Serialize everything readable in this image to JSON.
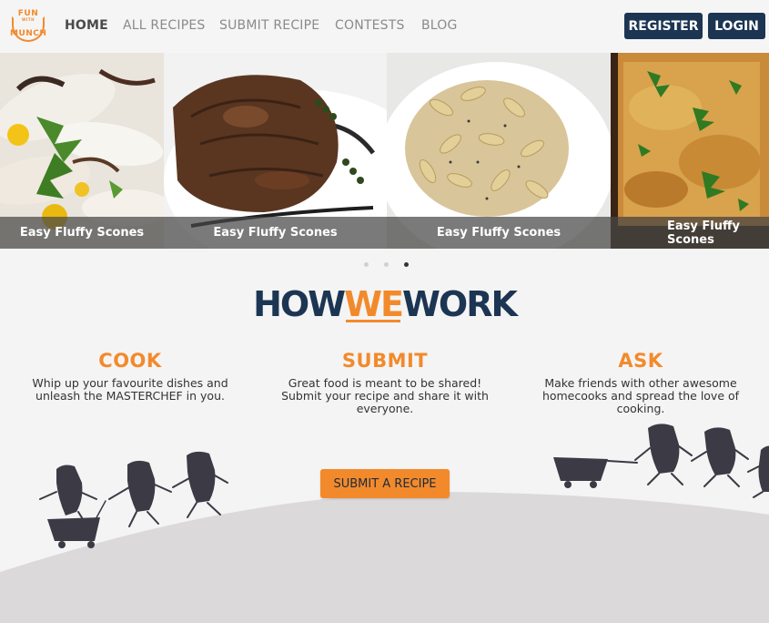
{
  "logo": {
    "line1": "FUN",
    "line2": "WITH",
    "line3": "MUNCH"
  },
  "nav": {
    "links": [
      "HOME",
      "ALL RECIPES",
      "SUBMIT RECIPE",
      "CONTESTS",
      "BLOG"
    ],
    "register": "REGISTER",
    "login": "LOGIN"
  },
  "carousel": {
    "captions": [
      "Easy Fluffy Scones",
      "Easy Fluffy Scones",
      "Easy Fluffy Scones",
      "Easy Fluffy Scones"
    ],
    "active_dot": 3
  },
  "how": {
    "before": "HOW",
    "we": "WE",
    "after": "WORK"
  },
  "columns": [
    {
      "title": "COOK",
      "text": "Whip up your favourite dishes and unleash the MASTERCHEF in you."
    },
    {
      "title": "SUBMIT",
      "text": "Great food is meant to be shared! Submit your recipe and share it with everyone."
    },
    {
      "title": "ASK",
      "text": "Make friends with other awesome homecooks and spread the love of cooking."
    }
  ],
  "submit_button": "SUBMIT A RECIPE",
  "colors": {
    "accent": "#f28a2c",
    "navy": "#1c3553",
    "figure": "#3b3a45",
    "hill": "#dcd9da"
  }
}
